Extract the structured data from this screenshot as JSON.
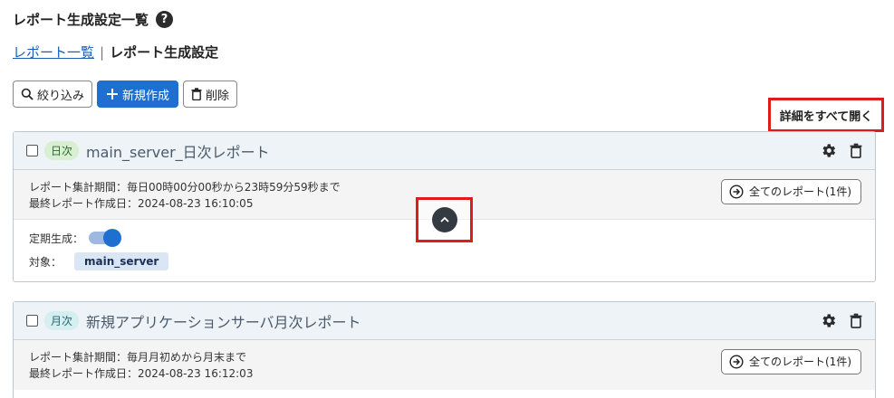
{
  "page": {
    "title": "レポート生成設定一覧",
    "help_icon": "?"
  },
  "breadcrumb": {
    "link": "レポート一覧",
    "separator": "|",
    "current": "レポート生成設定"
  },
  "toolbar": {
    "filter_label": "絞り込み",
    "new_label": "新規作成",
    "delete_label": "削除"
  },
  "expand_all_label": "詳細をすべて開く",
  "cards": [
    {
      "badge": "日次",
      "title": "main_server_日次レポート",
      "period": "レポート集計期間：毎日00時00分00秒から23時59分59秒まで",
      "last_created": "最終レポート作成日：2024-08-23 16:10:05",
      "all_reports": "全てのレポート(1件)",
      "schedule_label": "定期生成：",
      "schedule_on": true,
      "target_label": "対象：",
      "target_value": "main_server"
    },
    {
      "badge": "月次",
      "title": "新規アプリケーションサーバ月次レポート",
      "period": "レポート集計期間：毎月月初めから月末まで",
      "last_created": "最終レポート作成日：2024-08-23 16:12:03",
      "all_reports": "全てのレポート(1件)"
    }
  ],
  "colors": {
    "primary": "#1f6fd1",
    "highlight": "#e01b1b",
    "card_border": "#b9c7d6"
  },
  "icons": [
    "help-icon",
    "search-icon",
    "plus-icon",
    "trash-icon",
    "gear-icon",
    "arrow-circle-right-icon",
    "chevron-up-icon"
  ]
}
